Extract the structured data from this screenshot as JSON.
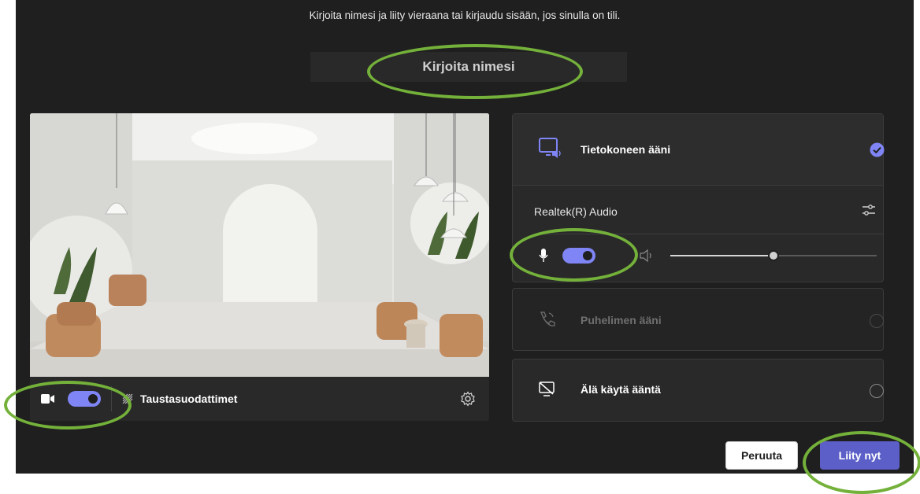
{
  "hint_text": "Kirjoita nimesi ja liity vieraana tai kirjaudu sisään, jos sinulla on tili.",
  "name_input": {
    "placeholder": "Kirjoita nimesi",
    "value": ""
  },
  "preview": {
    "camera_on": true,
    "background_filters_label": "Taustasuodattimet"
  },
  "audio_options": {
    "computer": {
      "label": "Tietokoneen ääni",
      "selected": true,
      "device": "Realtek(R) Audio",
      "mic_on": true,
      "speaker_volume": 0.5
    },
    "phone": {
      "label": "Puhelimen ääni",
      "selected": false,
      "disabled": true
    },
    "none": {
      "label": "Älä käytä ääntä",
      "selected": false
    }
  },
  "buttons": {
    "cancel": "Peruuta",
    "join": "Liity nyt"
  },
  "colors": {
    "accent": "#7f85f5",
    "background": "#1f1f1f",
    "panel": "#292929",
    "highlight_ring": "#74b13a"
  }
}
